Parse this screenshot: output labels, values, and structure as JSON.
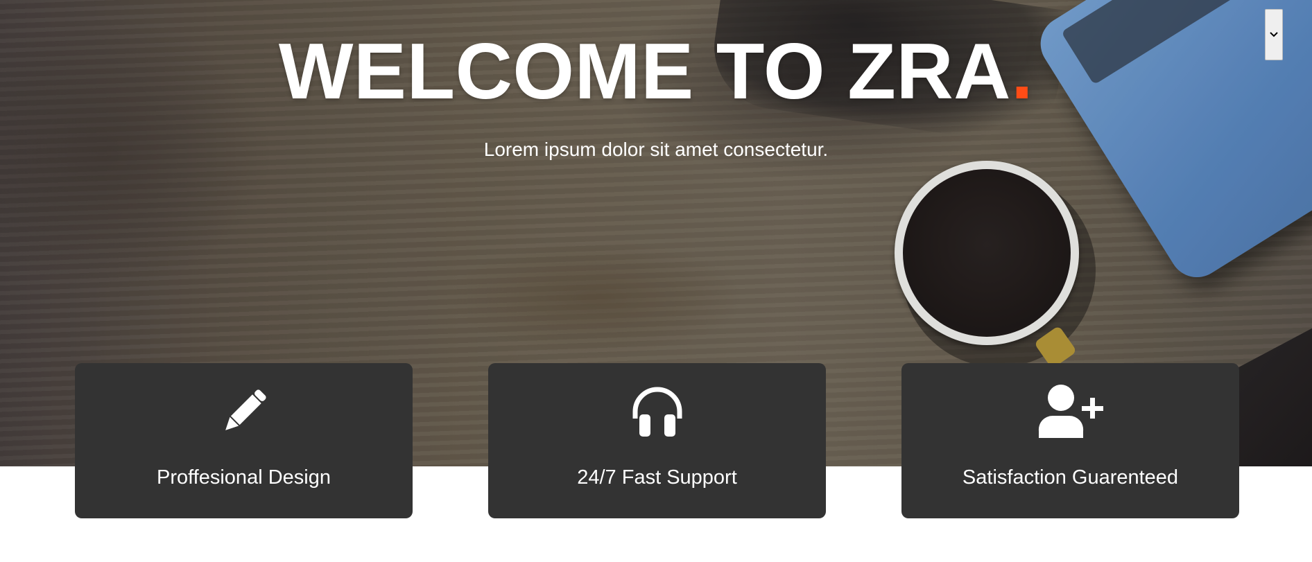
{
  "hero": {
    "title_main": "WELCOME TO ZRA",
    "title_dot": ".",
    "subtitle": "Lorem ipsum dolor sit amet consectetur.",
    "accent_color": "#ff4c16"
  },
  "nav_toggle": {
    "icon": "chevron-down-icon"
  },
  "features": [
    {
      "icon": "pencil-icon",
      "label": "Proffesional Design"
    },
    {
      "icon": "headphones-icon",
      "label": "24/7 Fast Support"
    },
    {
      "icon": "user-plus-icon",
      "label": "Satisfaction Guarenteed"
    }
  ],
  "colors": {
    "card_bg": "#333333",
    "text": "#ffffff"
  }
}
